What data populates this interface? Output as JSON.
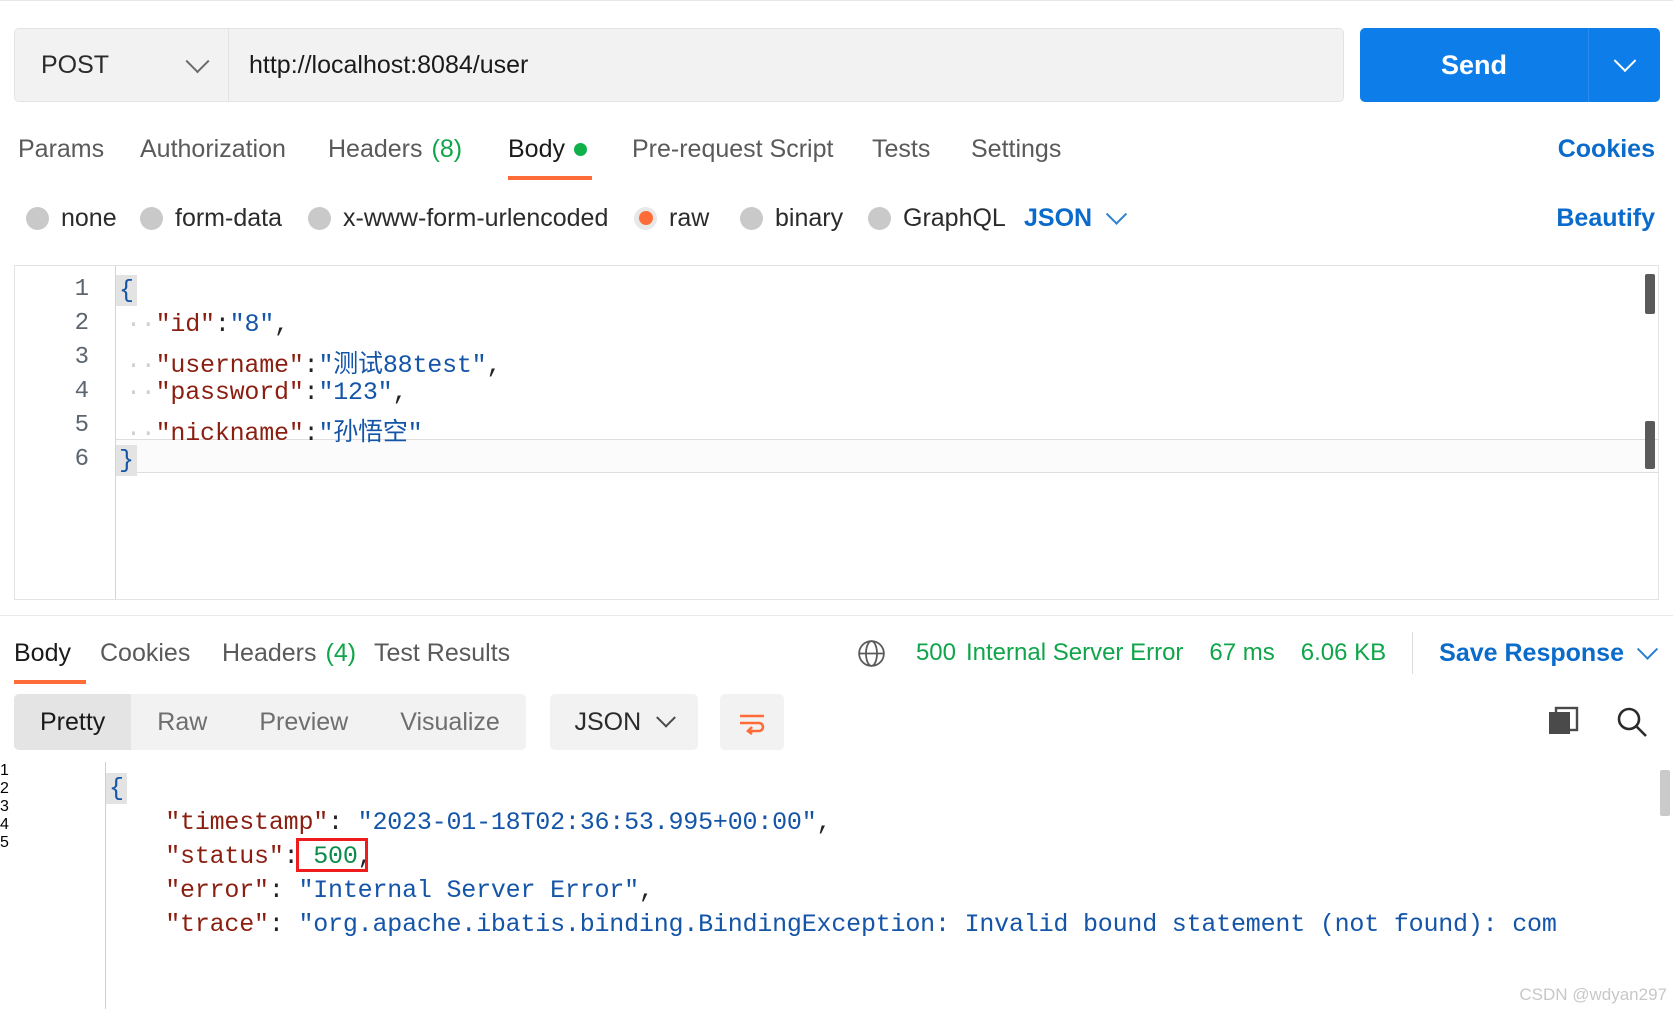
{
  "request": {
    "method": "POST",
    "url": "http://localhost:8084/user",
    "send_label": "Send",
    "tabs": [
      {
        "label": "Params",
        "active": false
      },
      {
        "label": "Authorization",
        "active": false
      },
      {
        "label": "Headers",
        "count": "(8)",
        "active": false
      },
      {
        "label": "Body",
        "active": true,
        "dot": true
      },
      {
        "label": "Pre-request Script",
        "active": false
      },
      {
        "label": "Tests",
        "active": false
      },
      {
        "label": "Settings",
        "active": false
      }
    ],
    "cookies_label": "Cookies",
    "body_types": [
      {
        "label": "none",
        "selected": false
      },
      {
        "label": "form-data",
        "selected": false
      },
      {
        "label": "x-www-form-urlencoded",
        "selected": false
      },
      {
        "label": "raw",
        "selected": true
      },
      {
        "label": "binary",
        "selected": false
      },
      {
        "label": "GraphQL",
        "selected": false
      }
    ],
    "format_label": "JSON",
    "beautify_label": "Beautify",
    "body_lines": [
      {
        "n": "1",
        "tokens": [
          {
            "t": "{",
            "c": "brace"
          }
        ]
      },
      {
        "n": "2",
        "tokens": [
          {
            "t": "··",
            "c": "ind"
          },
          {
            "t": "\"id\"",
            "c": "k"
          },
          {
            "t": ":",
            "c": "pun"
          },
          {
            "t": "\"8\"",
            "c": "str"
          },
          {
            "t": ",",
            "c": "pun"
          }
        ]
      },
      {
        "n": "3",
        "tokens": [
          {
            "t": "··",
            "c": "ind"
          },
          {
            "t": "\"username\"",
            "c": "k"
          },
          {
            "t": ":",
            "c": "pun"
          },
          {
            "t": "\"测试88test\"",
            "c": "str"
          },
          {
            "t": ",",
            "c": "pun"
          }
        ]
      },
      {
        "n": "4",
        "tokens": [
          {
            "t": "··",
            "c": "ind"
          },
          {
            "t": "\"password\"",
            "c": "k"
          },
          {
            "t": ":",
            "c": "pun"
          },
          {
            "t": "\"123\"",
            "c": "str"
          },
          {
            "t": ",",
            "c": "pun"
          }
        ]
      },
      {
        "n": "5",
        "tokens": [
          {
            "t": "··",
            "c": "ind"
          },
          {
            "t": "\"nickname\"",
            "c": "k"
          },
          {
            "t": ":",
            "c": "pun"
          },
          {
            "t": "\"孙悟空\"",
            "c": "str"
          }
        ]
      },
      {
        "n": "6",
        "tokens": [
          {
            "t": "}",
            "c": "brace"
          }
        ]
      }
    ]
  },
  "response": {
    "tabs": [
      {
        "label": "Body",
        "active": true
      },
      {
        "label": "Cookies",
        "active": false
      },
      {
        "label": "Headers",
        "count": "(4)",
        "active": false
      },
      {
        "label": "Test Results",
        "active": false
      }
    ],
    "status_code": "500",
    "status_text": "Internal Server Error",
    "time": "67 ms",
    "size": "6.06 KB",
    "save_label": "Save Response",
    "views": [
      {
        "label": "Pretty",
        "active": true
      },
      {
        "label": "Raw",
        "active": false
      },
      {
        "label": "Preview",
        "active": false
      },
      {
        "label": "Visualize",
        "active": false
      }
    ],
    "format_label": "JSON",
    "body_lines": [
      {
        "n": "1",
        "tokens": [
          {
            "t": "{",
            "c": "brace"
          }
        ]
      },
      {
        "n": "2",
        "tokens": [
          {
            "t": "    ",
            "c": "pun"
          },
          {
            "t": "\"timestamp\"",
            "c": "k"
          },
          {
            "t": ": ",
            "c": "pun"
          },
          {
            "t": "\"2023-01-18T02:36:53.995+00:00\"",
            "c": "str"
          },
          {
            "t": ",",
            "c": "pun"
          }
        ]
      },
      {
        "n": "3",
        "tokens": [
          {
            "t": "    ",
            "c": "pun"
          },
          {
            "t": "\"status\"",
            "c": "k"
          },
          {
            "t": ": ",
            "c": "pun"
          },
          {
            "t": "500",
            "c": "num"
          },
          {
            "t": ",",
            "c": "pun"
          }
        ]
      },
      {
        "n": "4",
        "tokens": [
          {
            "t": "    ",
            "c": "pun"
          },
          {
            "t": "\"error\"",
            "c": "k"
          },
          {
            "t": ": ",
            "c": "pun"
          },
          {
            "t": "\"Internal Server Error\"",
            "c": "str"
          },
          {
            "t": ",",
            "c": "pun"
          }
        ]
      },
      {
        "n": "5",
        "tokens": [
          {
            "t": "    ",
            "c": "pun"
          },
          {
            "t": "\"trace\"",
            "c": "k"
          },
          {
            "t": ": ",
            "c": "pun"
          },
          {
            "t": "\"org.apache.ibatis.binding.BindingException: Invalid bound statement (not found): com",
            "c": "str"
          }
        ]
      }
    ]
  },
  "watermark": "CSDN @wdyan297",
  "colors": {
    "accent_orange": "#ff6c37",
    "link_blue": "#0b6bcb",
    "send_blue": "#0d7dea",
    "status_green": "#10a54a",
    "annotation_red": "#ee1c1c"
  }
}
